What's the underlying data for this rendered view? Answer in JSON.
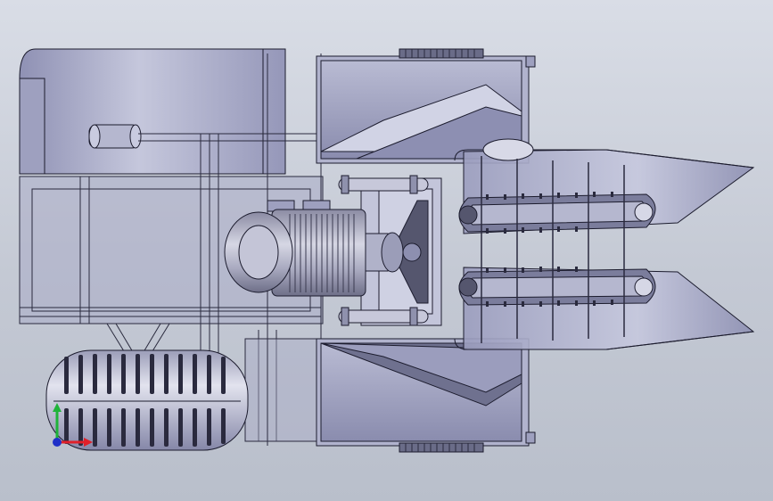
{
  "viewport": {
    "background_top": "#d9dde6",
    "background_bottom": "#b9bfcb",
    "part_fill": "#a6a8c4",
    "part_fill_light": "#c9cbe0",
    "part_fill_dark": "#7e80a3",
    "edge_color": "#1c1c2e"
  },
  "triad": {
    "x_color": "#e0202a",
    "y_color": "#1fb33a",
    "z_color": "#2030c8"
  },
  "icons": [
    "triad-icon"
  ]
}
